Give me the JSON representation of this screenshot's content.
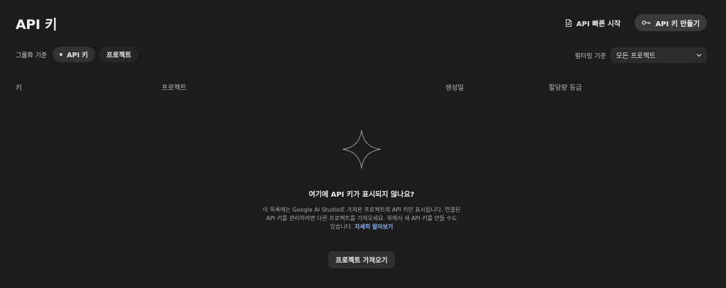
{
  "header": {
    "title": "API 키",
    "quickstart_label": "API 빠른 시작",
    "create_key_label": "API 키 만들기"
  },
  "grouping": {
    "label": "그룹화 기준",
    "options": [
      "API 키",
      "프로젝트"
    ],
    "selected": "API 키"
  },
  "filter": {
    "label": "필터링 기준",
    "selected": "모든 프로젝트"
  },
  "table": {
    "columns": [
      "키",
      "프로젝트",
      "생성일",
      "할당량 등급"
    ]
  },
  "empty_state": {
    "title": "여기에 API 키가 표시되지 않나요?",
    "description_line1": "이 목록에는 Google AI Studio로 가져온 프로젝트의 API 키만 표시됩니다. 연결된",
    "description_line2": "API 키를 관리하려면 다른 프로젝트를 가져오세요. 위에서 새 API 키를 만들 수도",
    "description_line3": "있습니다.",
    "link_label": "자세히 알아보기",
    "import_button_label": "프로젝트 가져오기"
  },
  "colors": {
    "background": "#1c1c1c",
    "link": "#8ab4f8"
  }
}
